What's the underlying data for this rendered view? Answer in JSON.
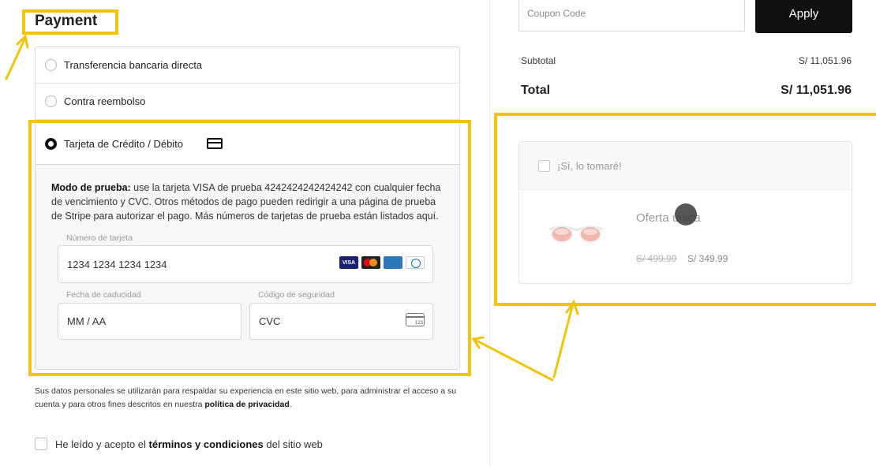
{
  "payment": {
    "title": "Payment",
    "methods": [
      {
        "label": "Transferencia bancaria directa",
        "selected": false
      },
      {
        "label": "Contra reembolso",
        "selected": false
      },
      {
        "label": "Tarjeta de Crédito / Débito",
        "selected": true
      }
    ],
    "test_mode_label": "Modo de prueba:",
    "test_mode_text": " use la tarjeta VISA de prueba 4242424242424242 con cualquier fecha de vencimiento y CVC. Otros métodos de pago pueden redirigir a una página de prueba de Stripe para autorizar el pago. Más números de tarjetas de prueba están listados aquí.",
    "card_number_label": "Número de tarjeta",
    "card_number_placeholder": "1234 1234 1234 1234",
    "expiry_label": "Fecha de caducidad",
    "expiry_placeholder": "MM / AA",
    "cvc_label": "Código de seguridad",
    "cvc_placeholder": "CVC",
    "cvc_icon_text": "123",
    "brands": [
      "VISA",
      "MasterCard",
      "AMEX",
      "Diners"
    ]
  },
  "privacy": {
    "text": "Sus datos personales se utilizarán para respaldar su experiencia en este sitio web, para administrar el acceso a su cuenta y para otros fines descritos en nuestra ",
    "link": "política de privacidad",
    "end": "."
  },
  "terms": {
    "pre": "He leído y acepto el ",
    "link": "términos y condiciones",
    "post": " del sitio web"
  },
  "summary": {
    "coupon_placeholder": "Coupon Code",
    "apply_label": "Apply",
    "subtotal_label": "Subtotal",
    "subtotal_value": "S/ 11,051.96",
    "total_label": "Total",
    "total_value": "S/ 11,051.96"
  },
  "offer": {
    "checkbox_label": "¡Sí, lo tomaré!",
    "title": "Oferta única",
    "old_price": "S/ 499.99",
    "new_price": "S/ 349.99"
  },
  "colors": {
    "highlight": "#f2c40f",
    "button": "#111111"
  }
}
